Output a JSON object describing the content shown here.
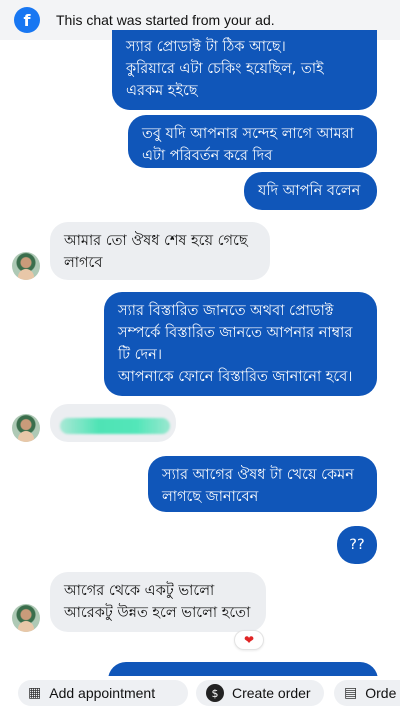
{
  "banner": {
    "icon": "facebook-icon",
    "text": "This chat was started from your ad."
  },
  "messages": [
    {
      "from": "page",
      "text": "স্যার প্রোডাক্ট টা ঠিক আছে।\nকুরিয়ারে এটা চেকিং হয়েছিল, তাই\nএরকম হইছে"
    },
    {
      "from": "page",
      "text": "তবু যদি আপনার সন্দেহ লাগে আমরা\nএটা পরিবর্তন করে দিব"
    },
    {
      "from": "page",
      "text": "যদি আপনি বলেন"
    },
    {
      "from": "customer",
      "text": "আমার তো ঔষধ শেষ হয়ে গেছে\nলাগবে"
    },
    {
      "from": "page",
      "text": "স্যার বিস্তারিত জানতে অথবা প্রোডাক্ট\nসম্পর্কে বিস্তারিত জানতে আপনার নাম্বার\nটি দেন।\nআপনাকে ফোনে বিস্তারিত জানানো হবে।"
    },
    {
      "from": "customer",
      "text": "",
      "redacted": true
    },
    {
      "from": "page",
      "text": "স্যার আগের ঔষধ টা খেয়ে কেমন\nলাগছে জানাবেন"
    },
    {
      "from": "page",
      "text": "??"
    },
    {
      "from": "customer",
      "text": "আগের থেকে একটু ভালো\nআরেকটু উন্নত হলে ভালো হতো",
      "reaction": "heart"
    }
  ],
  "actions": {
    "add_appointment": "Add appointment",
    "create_order": "Create order",
    "order_partial": "Orde"
  },
  "colors": {
    "outgoing": "#1056b9",
    "incoming": "#eceef1",
    "brand": "#1877f2",
    "redaction": "#4fe3b5"
  }
}
